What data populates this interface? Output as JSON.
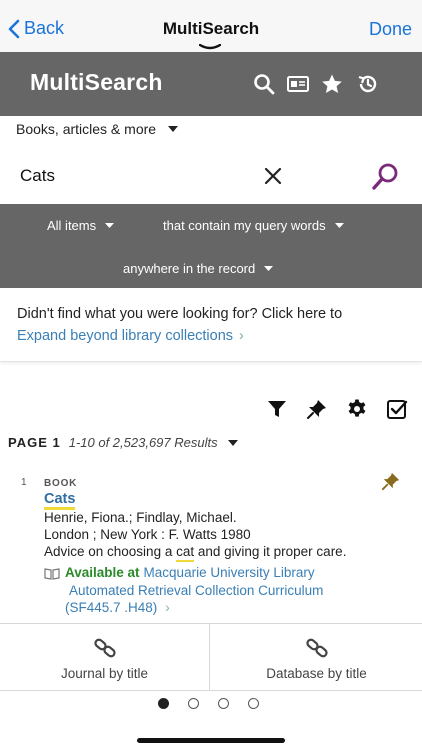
{
  "nav": {
    "back_label": "Back",
    "title": "MultiSearch",
    "done_label": "Done"
  },
  "header": {
    "logo": "MultiSearch",
    "icons": [
      "search-icon",
      "id-card-icon",
      "star-icon",
      "history-icon"
    ]
  },
  "search": {
    "scope": "Books, articles & more",
    "query": "Cats",
    "placeholder": ""
  },
  "options": {
    "items_filter": "All items",
    "match_filter": "that contain my query words",
    "field_filter": "anywhere in the record"
  },
  "expand": {
    "question": "Didn't find what you were looking for? Click here to",
    "link": "Expand beyond library collections"
  },
  "toolbar": {
    "icons": [
      "filter-icon",
      "pin-icon",
      "settings-icon",
      "checkbox-icon"
    ]
  },
  "results": {
    "page_label": "PAGE 1",
    "range_text": "1-10 of 2,523,697 Results",
    "records": [
      {
        "number": "1",
        "type": "BOOK",
        "title": "Cats",
        "authors": "Henrie, Fiona.; Findlay, Michael.",
        "publication": "London ; New York : F. Watts 1980",
        "description_before": "Advice on choosing a ",
        "description_highlight": "cat",
        "description_after": " and giving it proper care.",
        "availability_label": "Available at",
        "location": "Macquarie University Library",
        "collection": "Automated Retrieval Collection Curriculum",
        "call_number": "(SF445.7 .H48)"
      }
    ]
  },
  "tiles": [
    {
      "label": "Journal by title",
      "icon": "link-icon"
    },
    {
      "label": "Database by title",
      "icon": "link-icon"
    }
  ],
  "pager": {
    "count": 4,
    "active": 1
  },
  "colors": {
    "ios_blue": "#1a73d9",
    "header_gray": "#666666",
    "link_blue": "#3a7fb5",
    "available_green": "#2a8a2a",
    "highlight_yellow": "#f2d93a",
    "search_purple": "#7b2a7a",
    "pin_gold": "#8a6a1e"
  }
}
